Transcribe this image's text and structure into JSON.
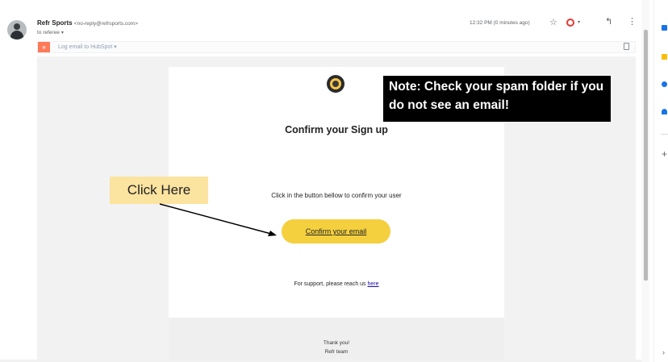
{
  "header": {
    "sender_name": "Refr Sports",
    "sender_email": "<no-reply@refrsports.com>",
    "recipient": "to referee",
    "timestamp": "12:32 PM (0 minutes ago)"
  },
  "hubspot": {
    "logo_text": "»",
    "label": "Log email to HubSpot ▾"
  },
  "email": {
    "title": "Confirm your Sign up",
    "instruction": "Click in the button bellow to confirm your user",
    "button_label": "Confirm your email",
    "support_text": "For support, please reach us",
    "support_link": "here",
    "footer_thanks": "Thank you!",
    "footer_team": "Refr team"
  },
  "annotations": {
    "note": "Note: Check your spam folder if you do not see an email!",
    "click_here": "Click Here"
  },
  "icons": {
    "star": "☆",
    "reply": "↰",
    "more": "⋮",
    "add": "+",
    "expand": "›",
    "caret": "▾"
  },
  "colors": {
    "button": "#f4d03f",
    "hubspot": "#ff7a59",
    "note_bg": "#000000",
    "click_here_bg": "#fbe3a0",
    "link": "#1a0dab"
  }
}
